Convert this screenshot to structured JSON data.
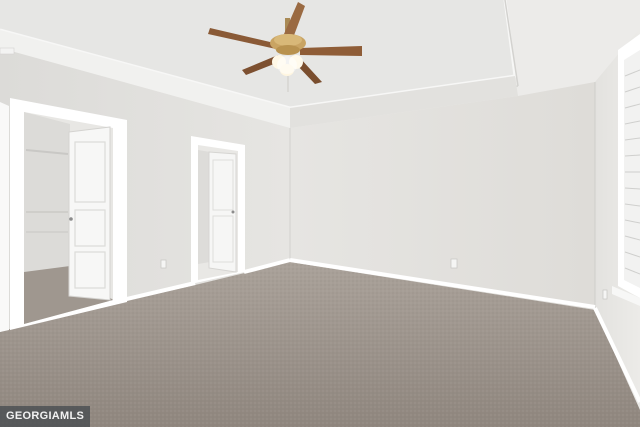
{
  "watermark": {
    "text": "GEORGIAMLS"
  },
  "colors": {
    "ceiling": "#ededeb",
    "tray_ceiling": "#e4e4e2",
    "wall_left": "#e3e2df",
    "wall_back": "#e7e6e3",
    "wall_right": "#e0dfdc",
    "trim": "#ffffff",
    "carpet": "#9a9189",
    "fan_blade": "#8a5a36",
    "fan_brass": "#c9a463"
  },
  "icons": [
    "ceiling-fan-icon"
  ]
}
